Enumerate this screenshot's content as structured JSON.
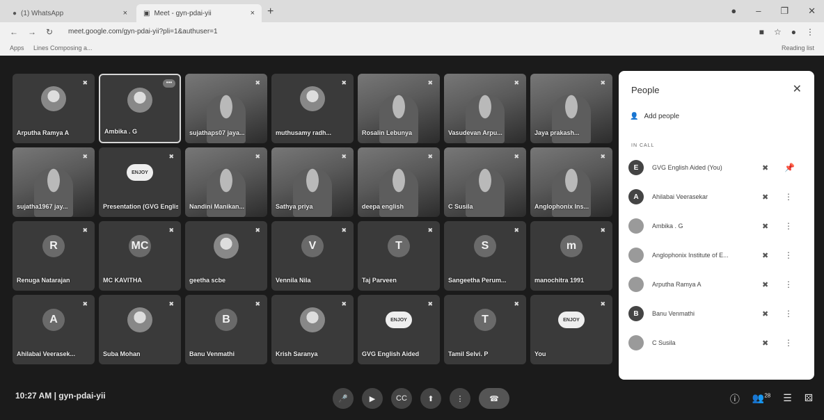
{
  "browser": {
    "tabs": [
      {
        "title": "(1) WhatsApp",
        "close": "×"
      },
      {
        "title": "Meet - gyn-pdai-yii",
        "close": "×"
      }
    ],
    "new_tab": "+",
    "url": "meet.google.com/gyn-pdai-yii?pli=1&authuser=1",
    "bookmarks": [
      "Apps",
      "Lines Composing a..."
    ],
    "reading_list": "Reading list"
  },
  "meeting": {
    "time": "10:27 AM",
    "separator": "|",
    "code": "gyn-pdai-yii",
    "tiles": [
      {
        "name": "Arputha Ramya A",
        "kind": "photo"
      },
      {
        "name": "Ambika . G",
        "kind": "photo"
      },
      {
        "name": "sujathaps07 jaya...",
        "kind": "video"
      },
      {
        "name": "muthusamy radh...",
        "kind": "photo"
      },
      {
        "name": "Rosalin Lebunya",
        "kind": "video"
      },
      {
        "name": "Vasudevan Arpu...",
        "kind": "video"
      },
      {
        "name": "Jaya prakash...",
        "kind": "video"
      },
      {
        "name": "sujatha1967 jay...",
        "kind": "video"
      },
      {
        "name": "Presentation (GVG English Aid...",
        "kind": "badge",
        "badge": "ENJOY"
      },
      {
        "name": "Nandini Manikan...",
        "kind": "video"
      },
      {
        "name": "Sathya priya",
        "kind": "video"
      },
      {
        "name": "deepa english",
        "kind": "video"
      },
      {
        "name": "C Susila",
        "kind": "video"
      },
      {
        "name": "Anglophonix Ins...",
        "kind": "video"
      },
      {
        "name": "Renuga Natarajan",
        "kind": "initial",
        "initial": "R"
      },
      {
        "name": "MC KAVITHA",
        "kind": "initial",
        "initial": "MC"
      },
      {
        "name": "geetha scbe",
        "kind": "photo"
      },
      {
        "name": "Vennila Nila",
        "kind": "initial",
        "initial": "V"
      },
      {
        "name": "Taj Parveen",
        "kind": "initial",
        "initial": "T"
      },
      {
        "name": "Sangeetha Perum...",
        "kind": "initial",
        "initial": "S"
      },
      {
        "name": "manochitra 1991",
        "kind": "initial",
        "initial": "m"
      },
      {
        "name": "Ahilabai Veerasek...",
        "kind": "initial",
        "initial": "A"
      },
      {
        "name": "Suba Mohan",
        "kind": "photo"
      },
      {
        "name": "Banu Venmathi",
        "kind": "initial",
        "initial": "B"
      },
      {
        "name": "Krish Saranya",
        "kind": "photo"
      },
      {
        "name": "GVG English Aided",
        "kind": "badge",
        "badge": "ENJOY"
      },
      {
        "name": "Tamil Selvi. P",
        "kind": "initial",
        "initial": "T"
      },
      {
        "name": "You",
        "kind": "badge",
        "badge": "ENJOY"
      }
    ]
  },
  "people": {
    "title": "People",
    "add_people": "Add people",
    "section": "IN CALL",
    "rows": [
      {
        "name": "GVG English Aided (You)",
        "avatar": "E"
      },
      {
        "name": "Ahilabai Veerasekar",
        "avatar": "A"
      },
      {
        "name": "Ambika . G",
        "avatar": ""
      },
      {
        "name": "Anglophonix Institute of E...",
        "avatar": ""
      },
      {
        "name": "Arputha Ramya A",
        "avatar": ""
      },
      {
        "name": "Banu Venmathi",
        "avatar": "B"
      },
      {
        "name": "C Susila",
        "avatar": ""
      }
    ]
  },
  "controls": {
    "participant_count": "28"
  }
}
